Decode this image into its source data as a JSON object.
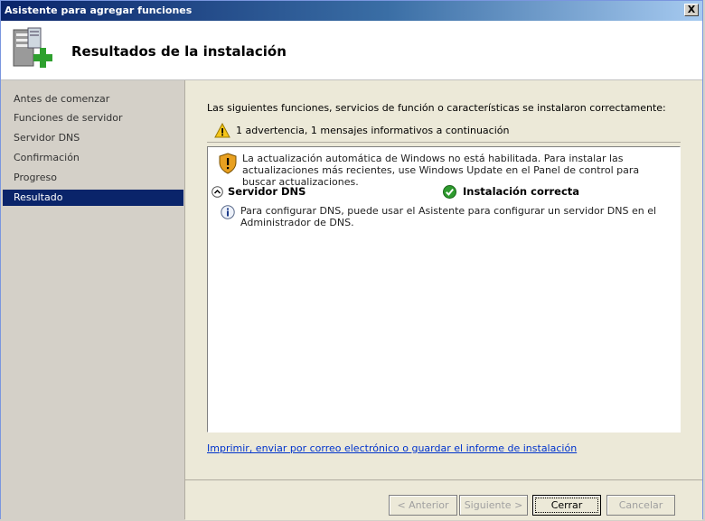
{
  "window": {
    "title": "Asistente para agregar funciones",
    "close_label": "X"
  },
  "header": {
    "title": "Resultados de la instalación"
  },
  "sidebar": {
    "items": [
      {
        "label": "Antes de comenzar",
        "active": false
      },
      {
        "label": "Funciones de servidor",
        "active": false
      },
      {
        "label": "Servidor DNS",
        "active": false
      },
      {
        "label": "Confirmación",
        "active": false
      },
      {
        "label": "Progreso",
        "active": false
      },
      {
        "label": "Resultado",
        "active": true
      }
    ]
  },
  "main": {
    "intro": "Las siguientes funciones, servicios de función o características se instalaron correctamente:",
    "summary": "1 advertencia, 1 mensajes informativos a continuación",
    "windows_update_warning": "La actualización automática de Windows no está habilitada. Para instalar las actualizaciones más recientes, use Windows Update en el Panel de control para buscar actualizaciones.",
    "role": {
      "name": "Servidor DNS",
      "status": "Instalación correcta"
    },
    "info_message": "Para configurar DNS, puede usar el Asistente para configurar un servidor DNS en el Administrador de DNS.",
    "report_link": "Imprimir, enviar por correo electrónico o guardar el informe de instalación"
  },
  "footer": {
    "back_label": "< Anterior",
    "next_label": "Siguiente >",
    "close_label": "Cerrar",
    "cancel_label": "Cancelar"
  },
  "colors": {
    "accent": "#0a246a",
    "link": "#0033cc",
    "success": "#2e9b2e",
    "warning": "#f0c020"
  }
}
